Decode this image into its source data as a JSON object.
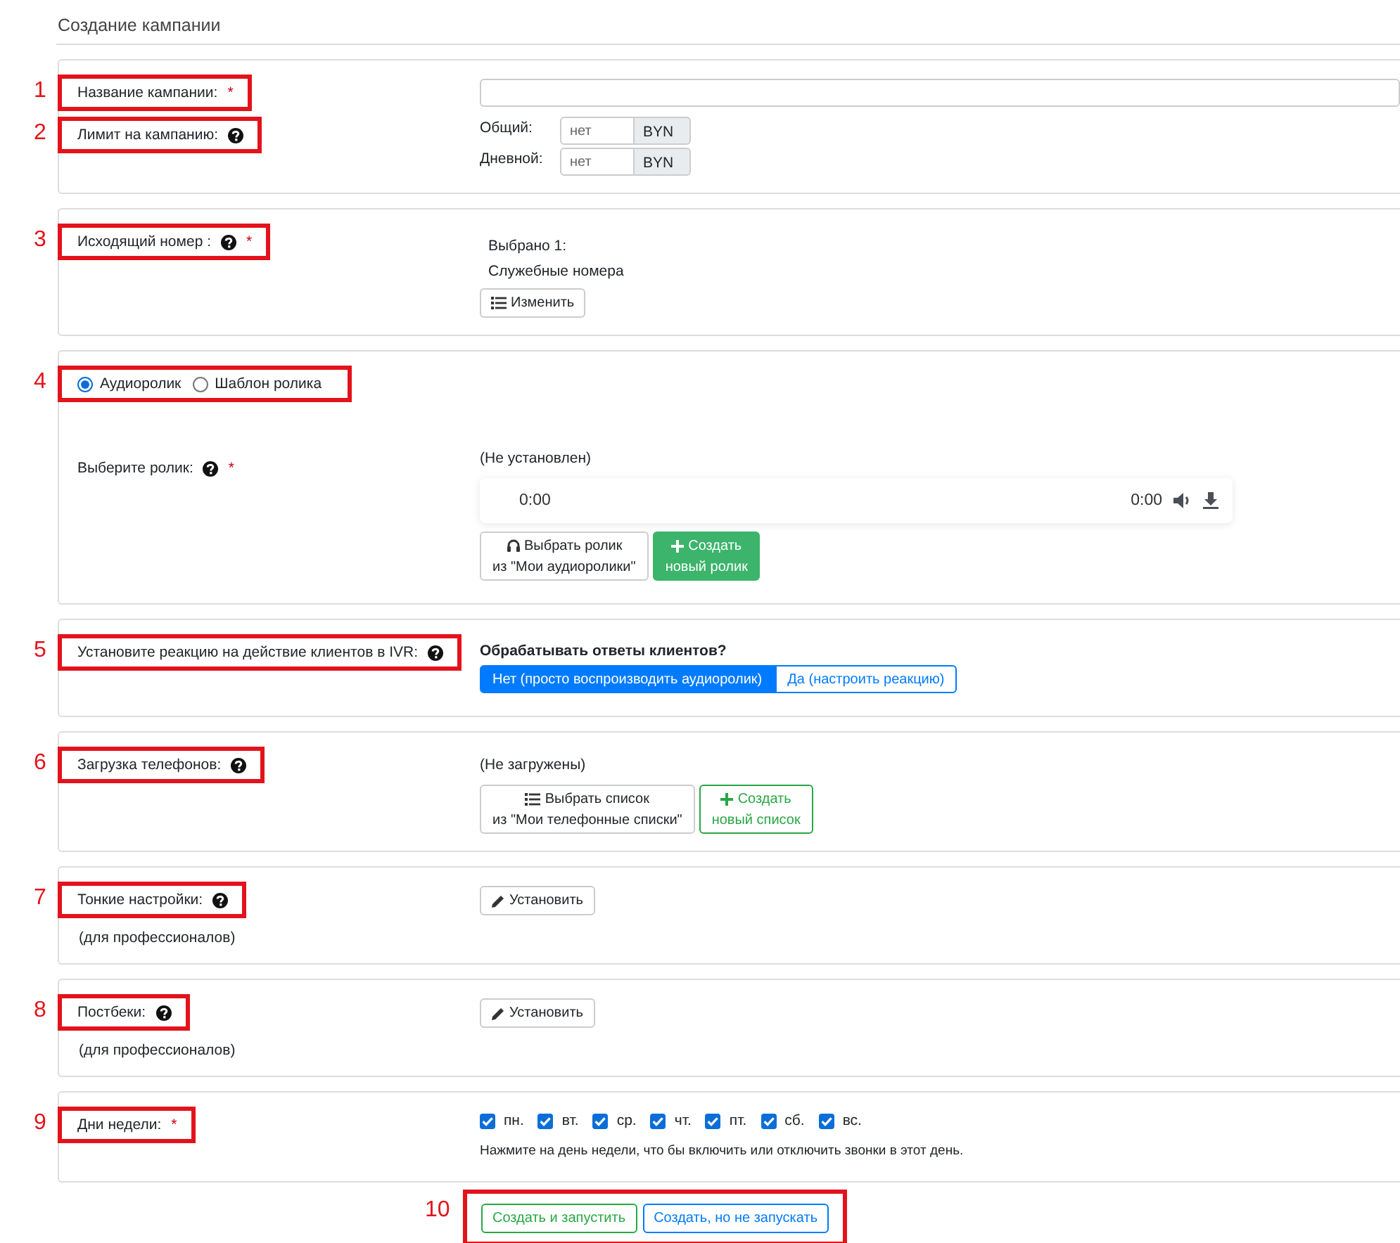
{
  "title": "Создание кампании",
  "cards": [
    {
      "rows": [
        {
          "kind": "text_input",
          "callout": "1",
          "label": "Название кампании:",
          "required_mark": "*",
          "help": false
        },
        {
          "kind": "limits",
          "callout": "2",
          "label": "Лимит на кампанию:",
          "help": true,
          "limits": [
            {
              "label": "Общий:",
              "placeholder": "нет",
              "unit": "BYN"
            },
            {
              "label": "Дневной:",
              "placeholder": "нет",
              "unit": "BYN"
            }
          ]
        }
      ]
    },
    {
      "rows": [
        {
          "kind": "selection",
          "callout": "3",
          "label": "Исходящий номер :",
          "help": true,
          "required_mark": "*",
          "count": "Выбрано 1:",
          "selection": "Служебные номера",
          "buttons": [
            {
              "kind": "change",
              "label": "Изменить"
            }
          ]
        }
      ]
    },
    {
      "rows": [
        {
          "kind": "radio_choice",
          "callout": "4",
          "options": [
            {
              "label": "Аудиоролик",
              "selected": true
            },
            {
              "label": "Шаблон ролика",
              "selected": false
            }
          ]
        },
        {
          "kind": "audio",
          "label": "Выберите ролик:",
          "help": true,
          "required_mark": "*",
          "status": "(Не установлен)",
          "player": {
            "current_time": "0:00",
            "duration": "0:00"
          },
          "buttons": [
            {
              "kind": "select_audio",
              "label": "Выбрать ролик\nиз \"Мои аудиоролики\""
            },
            {
              "kind": "create_audio",
              "label": "Создать\nновый ролик"
            }
          ]
        }
      ]
    },
    {
      "rows": [
        {
          "kind": "ivr",
          "callout": "5",
          "label": "Установите реакцию на действие клиентов в IVR:",
          "help": true,
          "question": "Обрабатывать ответы клиентов?",
          "options": [
            {
              "label": "Нет (просто воспроизводить аудиоролик)",
              "selected": true
            },
            {
              "label": "Да (настроить реакцию)",
              "selected": false
            }
          ]
        }
      ]
    },
    {
      "rows": [
        {
          "kind": "phones",
          "callout": "6",
          "label": "Загрузка телефонов:",
          "help": true,
          "status": "(Не загружены)",
          "buttons": [
            {
              "kind": "select_list",
              "label": "Выбрать список\nиз \"Мои телефонные списки\""
            },
            {
              "kind": "create_list",
              "label": "Создать\nновый список"
            }
          ]
        }
      ]
    },
    {
      "rows": [
        {
          "kind": "settings",
          "callout": "7",
          "label": "Тонкие настройки:",
          "help": true,
          "note": "(для профессионалов)",
          "buttons": [
            {
              "kind": "edit",
              "label": "Установить"
            }
          ]
        }
      ]
    },
    {
      "rows": [
        {
          "kind": "settings",
          "callout": "8",
          "label": "Постбеки:",
          "help": true,
          "note": "(для профессионалов)",
          "buttons": [
            {
              "kind": "edit",
              "label": "Установить"
            }
          ]
        }
      ]
    },
    {
      "rows": [
        {
          "kind": "days",
          "callout": "9",
          "label": "Дни недели:",
          "required_mark": "*",
          "days": [
            {
              "label": "пн.",
              "checked": true
            },
            {
              "label": "вт.",
              "checked": true
            },
            {
              "label": "ср.",
              "checked": true
            },
            {
              "label": "чт.",
              "checked": true
            },
            {
              "label": "пт.",
              "checked": true
            },
            {
              "label": "сб.",
              "checked": true
            },
            {
              "label": "вс.",
              "checked": true
            }
          ],
          "hint": "Нажмите на день недели, что бы включить или отключить звонки в этот день."
        }
      ]
    }
  ],
  "actions": {
    "callout": "10",
    "buttons": [
      {
        "kind": "create_start",
        "label": "Создать и запустить"
      },
      {
        "kind": "create_draft",
        "label": "Создать, но не запускать"
      }
    ]
  }
}
